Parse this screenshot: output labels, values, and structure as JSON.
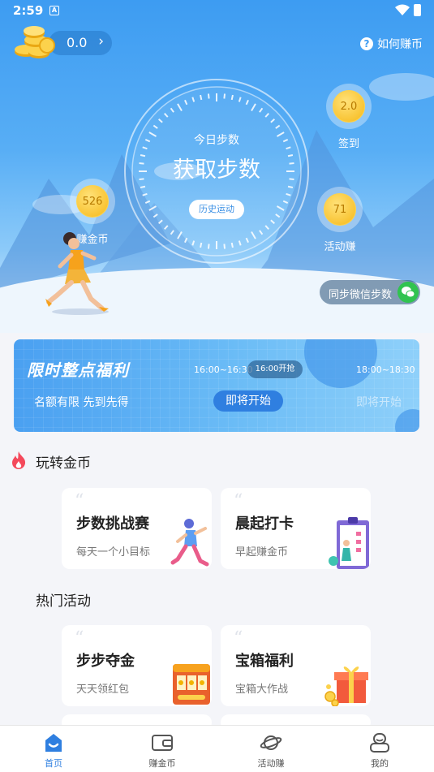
{
  "status": {
    "time": "2:59",
    "notif": "A"
  },
  "header": {
    "coin_balance": "0.0",
    "coin_arrow": "›",
    "howto_label": "如何赚币",
    "howto_icon": "?"
  },
  "dial": {
    "title": "今日步数",
    "main": "获取步数",
    "history_label": "历史运动"
  },
  "bubbles": {
    "earn": {
      "value": "526",
      "label": "赚金币"
    },
    "signin": {
      "value": "2.0",
      "label": "签到"
    },
    "activity": {
      "value": "71",
      "label": "活动赚"
    }
  },
  "sync": {
    "label": "同步微信步数"
  },
  "banner": {
    "title": "限时整点福利",
    "subtitle": "名额有限 先到先得",
    "slot1": "16:00~16:30",
    "slot_now": "16:00开抢",
    "slot3": "18:00~18:30",
    "start_label": "即将开始",
    "start_muted": "即将开始"
  },
  "sections": {
    "play_title": "玩转金币",
    "hot_title": "热门活动"
  },
  "cards": [
    {
      "title": "步数挑战赛",
      "subtitle": "每天一个小目标"
    },
    {
      "title": "晨起打卡",
      "subtitle": "早起赚金币"
    },
    {
      "title": "步步夺金",
      "subtitle": "天天领红包"
    },
    {
      "title": "宝箱福利",
      "subtitle": "宝箱大作战"
    }
  ],
  "card_quote": "“",
  "tabs": [
    {
      "label": "首页",
      "icon": "home-icon",
      "active": true
    },
    {
      "label": "赚金币",
      "icon": "wallet-icon",
      "active": false
    },
    {
      "label": "活动赚",
      "icon": "planet-icon",
      "active": false
    },
    {
      "label": "我的",
      "icon": "profile-icon",
      "active": false
    }
  ],
  "colors": {
    "primary": "#2f7fe0",
    "sky": "#3d9cf2",
    "coin": "#f6b817",
    "wechat": "#31c350"
  }
}
